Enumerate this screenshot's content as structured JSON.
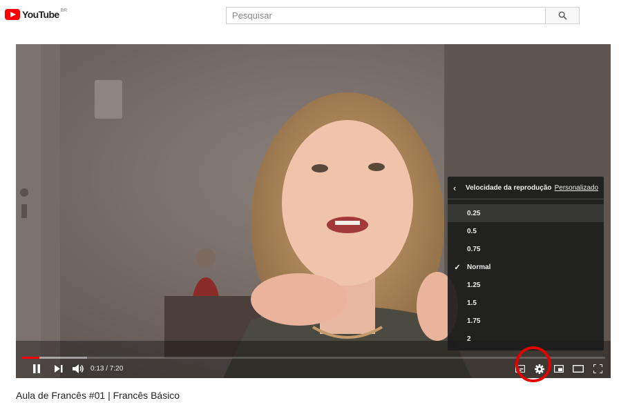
{
  "header": {
    "logo_text": "YouTube",
    "logo_country": "BR",
    "search_placeholder": "Pesquisar"
  },
  "player": {
    "current_time": "0:13",
    "duration": "7:20",
    "time_display": "0:13 / 7:20",
    "progress_played_fraction": 0.03,
    "progress_loaded_fraction": 0.11
  },
  "settings_menu": {
    "title": "Velocidade da reprodução",
    "custom_link": "Personalizado",
    "speeds": [
      "0.25",
      "0.5",
      "0.75",
      "Normal",
      "1.25",
      "1.5",
      "1.75",
      "2"
    ],
    "selected_speed": "Normal",
    "hovered_speed": "0.25"
  },
  "video": {
    "title": "Aula de Francês #01 | Francês Básico"
  },
  "colors": {
    "brand_red": "#ff0000",
    "annotation_red": "#e30000",
    "menu_bg": "#1c1c1c"
  },
  "icons": {
    "play_pause": "pause-icon",
    "next": "next-icon",
    "volume": "volume-icon",
    "subtitles": "subtitles-icon",
    "settings": "gear-icon",
    "miniplayer": "miniplayer-icon",
    "theater": "theater-mode-icon",
    "fullscreen": "fullscreen-icon",
    "back": "chevron-left-icon",
    "search": "search-icon"
  }
}
